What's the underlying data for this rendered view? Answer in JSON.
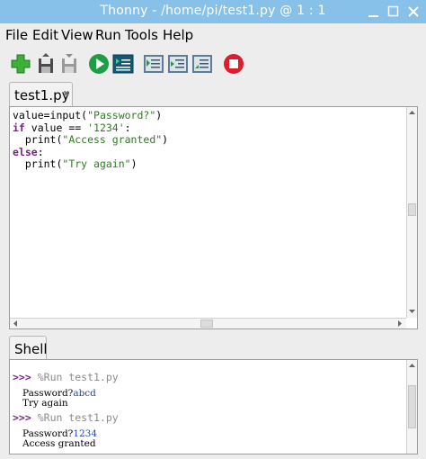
{
  "window": {
    "title": "Thonny  -  /home/pi/test1.py  @  1 : 1"
  },
  "menu": [
    "File",
    "Edit",
    "View",
    "Run",
    "Tools",
    "Help"
  ],
  "toolbar": [
    "new-file",
    "load",
    "save",
    "run",
    "debug",
    "step-over",
    "step-into",
    "step-out",
    "stop"
  ],
  "editor": {
    "tab_label": "test1.py",
    "tab_close": "✖",
    "code": [
      [
        {
          "t": "value=input(",
          "c": ""
        },
        {
          "t": "\"Password?\"",
          "c": "str"
        },
        {
          "t": ")",
          "c": ""
        }
      ],
      [
        {
          "t": "if",
          "c": "kw"
        },
        {
          "t": " value == ",
          "c": ""
        },
        {
          "t": "'1234'",
          "c": "str"
        },
        {
          "t": ":",
          "c": ""
        }
      ],
      [
        {
          "t": "  print(",
          "c": ""
        },
        {
          "t": "\"Access granted\"",
          "c": "str"
        },
        {
          "t": ")",
          "c": ""
        }
      ],
      [
        {
          "t": "else",
          "c": "kw"
        },
        {
          "t": ":",
          "c": ""
        }
      ],
      [
        {
          "t": "  print(",
          "c": ""
        },
        {
          "t": "\"Try again\"",
          "c": "str"
        },
        {
          "t": ")",
          "c": ""
        }
      ]
    ]
  },
  "shell": {
    "tab_label": "Shell",
    "runs": [
      {
        "prompt": ">>>",
        "command": "%Run test1.py",
        "output_label": "Password?",
        "input": "abcd",
        "result": "Try again"
      },
      {
        "prompt": ">>>",
        "command": "%Run test1.py",
        "output_label": "Password?",
        "input": "1234",
        "result": "Access granted"
      }
    ]
  }
}
